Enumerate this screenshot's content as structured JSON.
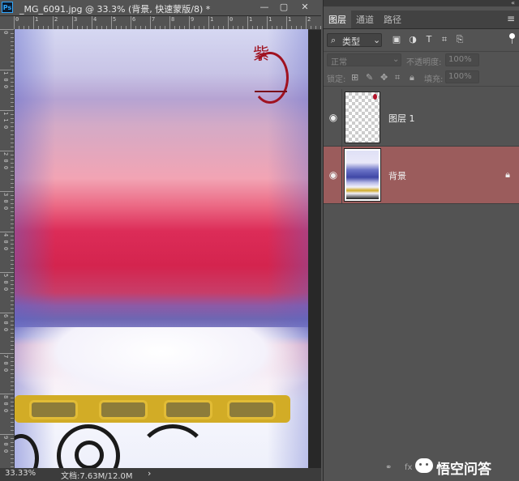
{
  "document": {
    "title": "_MG_6091.jpg @ 33.3% (背景, 快速蒙版/8) *",
    "app_icon": "Ps",
    "window_buttons": {
      "minimize": "—",
      "restore": "▢",
      "close": "✕"
    },
    "ruler_top": [
      "0",
      "1",
      "2",
      "3",
      "4",
      "5",
      "6",
      "7",
      "8",
      "9",
      "1",
      "0",
      "1",
      "1",
      "1",
      "2"
    ],
    "ruler_left": [
      "0",
      "1 0 0",
      "1 1 0",
      "2 0 0",
      "3 0 0",
      "4 0 0",
      "5 0 0",
      "6 0 0",
      "7 0 0",
      "8 0 0",
      "9 0 0"
    ],
    "seal_text": "紫",
    "status": {
      "zoom": "33.33%",
      "doc_info": "文档:7.63M/12.0M",
      "arrow": "›"
    }
  },
  "layers_panel": {
    "tabs": [
      "图层",
      "通道",
      "路径"
    ],
    "menu_icon": "≡",
    "filter": {
      "kind": "类型",
      "icons": [
        "image-filter-icon",
        "adjustment-filter-icon",
        "type-filter-icon",
        "shape-filter-icon",
        "smart-object-filter-icon"
      ]
    },
    "blend_mode": "正常",
    "opacity_label": "不透明度:",
    "opacity_value": "100%",
    "lock_label": "锁定:",
    "fill_label": "填充:",
    "fill_value": "100%",
    "layers": [
      {
        "name": "图层 1",
        "visible": true,
        "selected": false,
        "locked": false
      },
      {
        "name": "背景",
        "visible": true,
        "selected": true,
        "locked": true
      }
    ],
    "footer_icons": [
      "link-icon",
      "fx-icon"
    ]
  },
  "watermark": {
    "text": "悟空问答"
  }
}
